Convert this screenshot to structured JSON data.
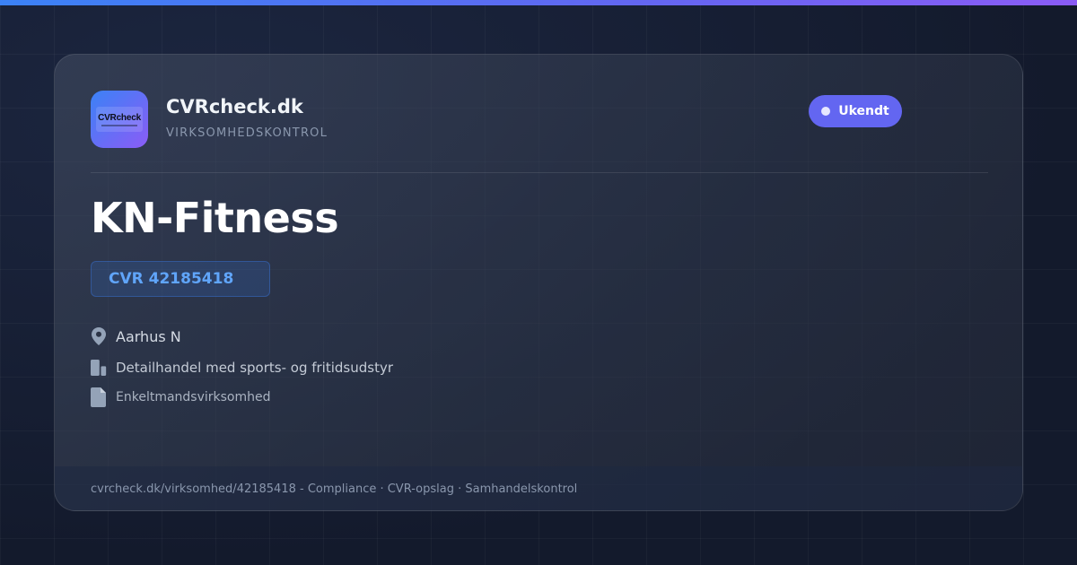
{
  "brand": {
    "logo_text": "CVRcheck",
    "name": "CVRcheck.dk",
    "tagline": "VIRKSOMHEDSKONTROL"
  },
  "status": {
    "label": "Ukendt",
    "color": "#6366f1"
  },
  "company": {
    "name": "KN-Fitness",
    "cvr": "CVR 42185418",
    "city": "Aarhus N",
    "industry": "Detailhandel med sports- og fritidsudstyr",
    "legal_form": "Enkeltmandsvirksomhed"
  },
  "icons": {
    "city": "location-pin-icon",
    "industry": "building-icon",
    "legal_form": "document-icon"
  },
  "footer": {
    "text": "cvrcheck.dk/virksomhed/42185418 - Compliance · CVR-opslag · Samhandelskontrol"
  },
  "colors": {
    "accent_blue": "#3b82f6",
    "accent_purple": "#8b5cf6",
    "cvr_text": "#60a5fa",
    "background": "#141c2f"
  }
}
